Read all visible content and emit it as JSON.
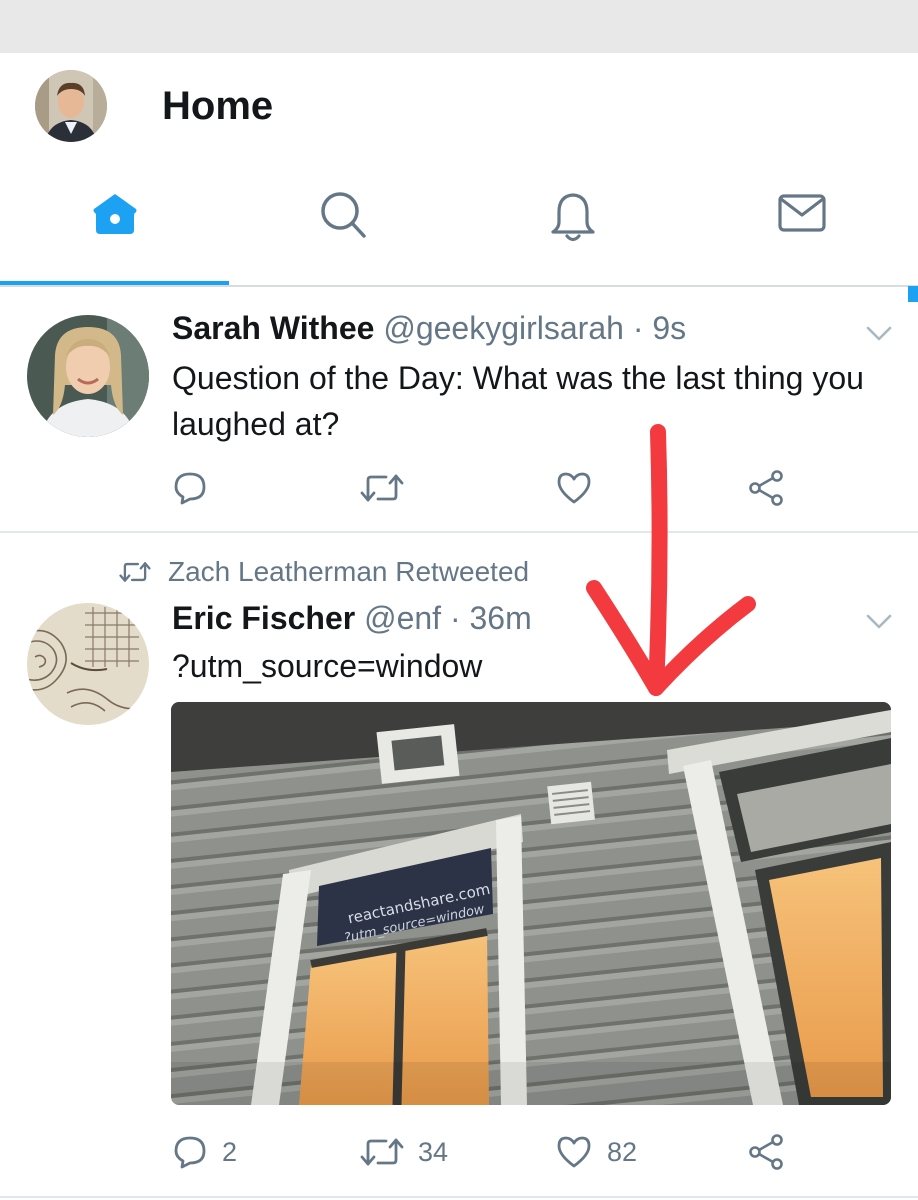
{
  "header": {
    "title": "Home",
    "tabs": [
      {
        "name": "home",
        "icon": "home-icon"
      },
      {
        "name": "search",
        "icon": "search-icon"
      },
      {
        "name": "notifications",
        "icon": "bell-icon"
      },
      {
        "name": "messages",
        "icon": "mail-icon"
      }
    ],
    "active_tab": "home"
  },
  "colors": {
    "accent": "#1da1f2",
    "secondary_text": "#657786",
    "annotation_arrow": "#f23a3f"
  },
  "tweets": [
    {
      "name": "Sarah Withee",
      "handle": "@geekygirlsarah",
      "separator": "·",
      "time": "9s",
      "text": "Question of the Day: What was the last thing you laughed at?",
      "actions": {
        "reply": "",
        "retweet": "",
        "like": "",
        "share": ""
      }
    },
    {
      "retweeted_by": "Zach Leatherman Retweeted",
      "name": "Eric Fischer",
      "handle": "@enf",
      "separator": "·",
      "time": "36m",
      "text": "?utm_source=window",
      "media": {
        "sign_line1": "reactandshare.com",
        "sign_line2": "?utm_source=window"
      },
      "actions": {
        "reply": "2",
        "retweet": "34",
        "like": "82",
        "share": ""
      }
    }
  ]
}
